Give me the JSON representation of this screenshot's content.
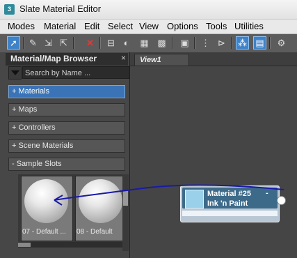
{
  "window": {
    "title": "Slate Material Editor",
    "icon": "3ds-max-icon"
  },
  "menubar": {
    "items": [
      "Modes",
      "Material",
      "Edit",
      "Select",
      "View",
      "Options",
      "Tools",
      "Utilities"
    ]
  },
  "toolbar": {
    "icons": [
      "select-arrow-icon",
      "eyedropper-icon",
      "put-to-scene-icon",
      "assign-material-icon",
      "delete-icon",
      "move-children-icon",
      "sample-type-icon",
      "background-icon",
      "layout-icon",
      "show-map-icon",
      "layout-all-icon",
      "arrange-icon",
      "material-map-browser-icon",
      "parameter-editor-icon",
      "select-by-material-icon"
    ]
  },
  "browser": {
    "title": "Material/Map Browser",
    "close_label": "×",
    "search": {
      "placeholder": "Search by Name ...",
      "value": ""
    },
    "rollouts": [
      {
        "label": "+ Materials",
        "selected": true
      },
      {
        "label": "+ Maps",
        "selected": false
      },
      {
        "label": "+ Controllers",
        "selected": false
      },
      {
        "label": "+ Scene Materials",
        "selected": false
      },
      {
        "label": "- Sample Slots",
        "selected": false
      }
    ],
    "slots": [
      {
        "label": "07 - Default ..."
      },
      {
        "label": "08 - Default"
      }
    ]
  },
  "view": {
    "tab_label": "View1",
    "node": {
      "title": "Material #25",
      "subtitle": "Ink 'n Paint",
      "collapse_label": "-"
    }
  },
  "colors": {
    "selected_accent": "#3a73b6",
    "annotation_arrow": "#1a1aa8",
    "node_header": "#3e6a8a"
  }
}
